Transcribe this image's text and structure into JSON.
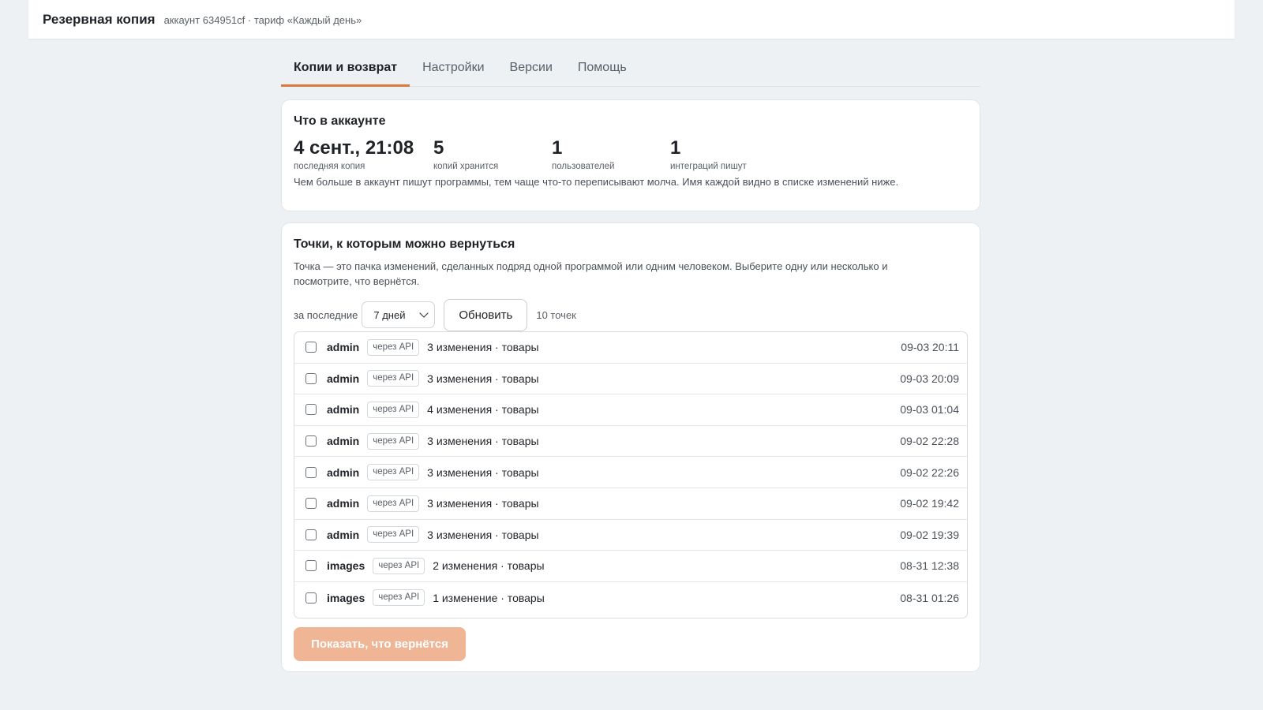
{
  "header": {
    "title": "Резервная копия",
    "account": "аккаунт 634951cf · тариф «Каждый день»"
  },
  "tabs": [
    {
      "label": "Копии и возврат",
      "active": true
    },
    {
      "label": "Настройки",
      "active": false
    },
    {
      "label": "Версии",
      "active": false
    },
    {
      "label": "Помощь",
      "active": false
    }
  ],
  "summary": {
    "title": "Что в аккаунте",
    "stats": [
      {
        "value": "4 сент., 21:08",
        "label": "последняя копия"
      },
      {
        "value": "5",
        "label": "копий хранится"
      },
      {
        "value": "1",
        "label": "пользователей"
      },
      {
        "value": "1",
        "label": "интеграций пишут"
      }
    ],
    "note": "Чем больше в аккаунт пишут программы, тем чаще что-то переписывают молча. Имя каждой видно в списке изменений ниже."
  },
  "points": {
    "title": "Точки, к которым можно вернуться",
    "description": "Точка — это пачка изменений, сделанных подряд одной программой или одним человеком. Выберите одну или несколько и посмотрите, что вернётся.",
    "filter_label": "за последние",
    "period_selected": "7 дней",
    "refresh_label": "Обновить",
    "count_label": "10 точек",
    "rows": [
      {
        "author": "admin",
        "via": "через API",
        "changes": "3 изменения · товары",
        "time": "09-03 20:11"
      },
      {
        "author": "admin",
        "via": "через API",
        "changes": "3 изменения · товары",
        "time": "09-03 20:09"
      },
      {
        "author": "admin",
        "via": "через API",
        "changes": "4 изменения · товары",
        "time": "09-03 01:04"
      },
      {
        "author": "admin",
        "via": "через API",
        "changes": "3 изменения · товары",
        "time": "09-02 22:28"
      },
      {
        "author": "admin",
        "via": "через API",
        "changes": "3 изменения · товары",
        "time": "09-02 22:26"
      },
      {
        "author": "admin",
        "via": "через API",
        "changes": "3 изменения · товары",
        "time": "09-02 19:42"
      },
      {
        "author": "admin",
        "via": "через API",
        "changes": "3 изменения · товары",
        "time": "09-02 19:39"
      },
      {
        "author": "images",
        "via": "через API",
        "changes": "2 изменения · товары",
        "time": "08-31 12:38"
      },
      {
        "author": "images",
        "via": "через API",
        "changes": "1 изменение · товары",
        "time": "08-31 01:26"
      }
    ],
    "show_button_label": "Показать, что вернётся"
  },
  "colors": {
    "accent": "#d9793f",
    "accent_disabled": "#efb595",
    "background": "#eef1f4"
  }
}
